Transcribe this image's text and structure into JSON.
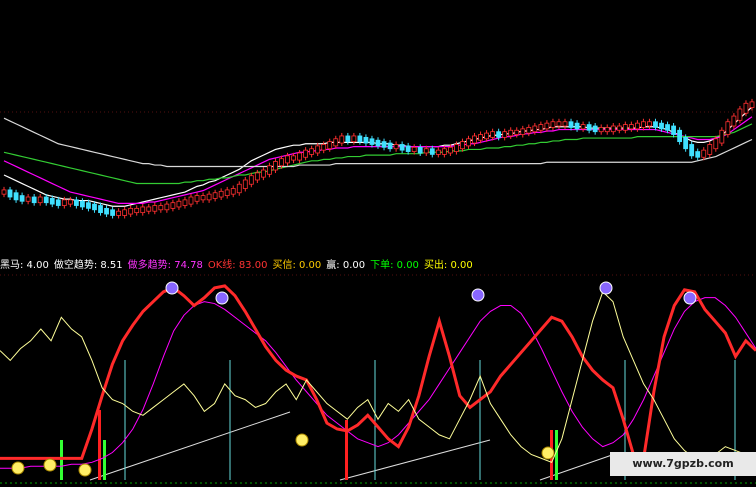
{
  "chart_data": [
    {
      "type": "candlestick",
      "title": "",
      "xlabel": "",
      "ylabel": "",
      "ylim": [
        0,
        100
      ],
      "series": [
        {
          "kind": "candles",
          "values_close": [
            38,
            36,
            34,
            33,
            33,
            32,
            33,
            32,
            31,
            30,
            31,
            31,
            30,
            29,
            28,
            27,
            25,
            24,
            23,
            23,
            24,
            25,
            25,
            26,
            26,
            27,
            27,
            28,
            29,
            30,
            31,
            33,
            34,
            34,
            35,
            36,
            37,
            38,
            39,
            42,
            45,
            48,
            50,
            52,
            55,
            58,
            60,
            62,
            62,
            64,
            66,
            67,
            69,
            70,
            72,
            74,
            76,
            75,
            76,
            75,
            74,
            73,
            72,
            71,
            70,
            70,
            69,
            68,
            68,
            67,
            67,
            66,
            66,
            67,
            68,
            70,
            72,
            74,
            76,
            77,
            78,
            79,
            78,
            79,
            80,
            80,
            81,
            82,
            83,
            84,
            85,
            86,
            86,
            86,
            85,
            84,
            84,
            83,
            82,
            82,
            82,
            83,
            83,
            84,
            84,
            85,
            86,
            86,
            85,
            84,
            83,
            80,
            75,
            70,
            65,
            64,
            66,
            70,
            74,
            80,
            86,
            90,
            95,
            99,
            100
          ]
        },
        {
          "kind": "ma",
          "color": "#ffffff",
          "values": [
            50,
            48,
            46,
            44,
            42,
            40,
            38,
            36,
            35,
            34,
            33,
            33,
            32,
            32,
            32,
            31,
            30,
            29,
            28,
            28,
            28,
            29,
            30,
            31,
            32,
            33,
            34,
            35,
            36,
            37,
            38,
            40,
            42,
            43,
            45,
            46,
            48,
            50,
            52,
            54,
            57,
            60,
            62,
            64,
            66,
            68,
            69,
            70,
            71,
            71,
            72,
            72,
            72,
            72,
            73,
            73,
            73,
            73,
            73,
            73,
            73,
            73,
            72,
            72,
            72,
            71,
            71,
            70,
            70,
            70,
            70,
            70,
            70,
            71,
            71,
            72,
            73,
            74,
            75,
            76,
            77,
            78,
            78,
            79,
            79,
            80,
            81,
            81,
            82,
            82,
            83,
            84,
            84,
            84,
            84,
            84,
            84,
            83,
            83,
            83,
            83,
            83,
            83,
            83,
            83,
            83,
            84,
            84,
            84,
            83,
            82,
            80,
            78,
            76,
            74,
            73,
            73,
            74,
            76,
            78,
            82,
            86,
            90,
            94,
            98
          ]
        },
        {
          "kind": "ma",
          "color": "#ff00ff",
          "values": [
            60,
            58,
            56,
            54,
            52,
            50,
            48,
            46,
            44,
            42,
            40,
            38,
            37,
            36,
            35,
            34,
            33,
            32,
            31,
            30,
            30,
            30,
            30,
            30,
            31,
            31,
            32,
            33,
            34,
            35,
            36,
            37,
            38,
            39,
            41,
            43,
            45,
            47,
            49,
            51,
            53,
            55,
            57,
            59,
            61,
            62,
            63,
            64,
            65,
            66,
            66,
            67,
            67,
            68,
            68,
            69,
            69,
            69,
            70,
            70,
            70,
            70,
            70,
            70,
            70,
            70,
            70,
            70,
            70,
            70,
            70,
            70,
            70,
            70,
            70,
            71,
            71,
            72,
            72,
            73,
            74,
            75,
            76,
            77,
            77,
            78,
            79,
            79,
            80,
            80,
            81,
            81,
            82,
            82,
            82,
            82,
            82,
            82,
            82,
            82,
            82,
            82,
            82,
            82,
            82,
            82,
            82,
            82,
            82,
            81,
            80,
            79,
            78,
            77,
            76,
            75,
            75,
            75,
            76,
            77,
            79,
            82,
            85,
            88,
            91
          ]
        },
        {
          "kind": "ma",
          "color": "#33cc33",
          "values": [
            66,
            65,
            64,
            63,
            62,
            61,
            60,
            59,
            58,
            57,
            56,
            55,
            54,
            53,
            52,
            51,
            50,
            49,
            48,
            47,
            46,
            45,
            44,
            44,
            44,
            44,
            44,
            44,
            44,
            44,
            45,
            45,
            46,
            46,
            47,
            47,
            48,
            48,
            49,
            50,
            50,
            51,
            52,
            52,
            53,
            54,
            55,
            56,
            57,
            58,
            59,
            60,
            60,
            61,
            61,
            62,
            62,
            63,
            63,
            63,
            64,
            64,
            64,
            64,
            64,
            65,
            65,
            65,
            65,
            65,
            66,
            66,
            66,
            66,
            67,
            67,
            67,
            68,
            68,
            68,
            69,
            69,
            69,
            70,
            70,
            71,
            71,
            72,
            72,
            73,
            73,
            74,
            74,
            75,
            75,
            75,
            76,
            76,
            76,
            76,
            76,
            76,
            76,
            76,
            76,
            77,
            77,
            77,
            77,
            77,
            77,
            77,
            77,
            77,
            77,
            77,
            77,
            77,
            77,
            78,
            79,
            80,
            82,
            84,
            86
          ]
        },
        {
          "kind": "ma",
          "color": "#d9d9d9",
          "values": [
            90,
            88,
            86,
            84,
            82,
            80,
            78,
            76,
            74,
            72,
            71,
            70,
            69,
            68,
            67,
            66,
            65,
            64,
            63,
            62,
            61,
            60,
            59,
            58,
            58,
            57,
            57,
            56,
            56,
            56,
            56,
            56,
            56,
            56,
            56,
            56,
            56,
            56,
            56,
            56,
            56,
            56,
            56,
            56,
            56,
            56,
            56,
            56,
            56,
            57,
            57,
            57,
            57,
            57,
            57,
            58,
            58,
            58,
            58,
            58,
            58,
            58,
            58,
            58,
            58,
            58,
            58,
            58,
            58,
            58,
            58,
            58,
            58,
            58,
            58,
            58,
            58,
            58,
            58,
            58,
            58,
            58,
            58,
            58,
            58,
            58,
            58,
            58,
            58,
            58,
            59,
            59,
            59,
            59,
            59,
            59,
            59,
            59,
            59,
            59,
            59,
            59,
            59,
            59,
            59,
            59,
            59,
            59,
            59,
            59,
            59,
            59,
            59,
            59,
            59,
            60,
            61,
            62,
            63,
            65,
            67,
            69,
            71,
            73,
            75
          ]
        }
      ]
    },
    {
      "type": "line",
      "legend": [
        {
          "text": "黑马: 4.00",
          "color": "#ffffff"
        },
        {
          "text": "做空趋势: 8.51",
          "color": "#ffffff"
        },
        {
          "text": "做多趋势: 74.78",
          "color": "#ff33ff"
        },
        {
          "text": "OK线: 83.00",
          "color": "#ff3333"
        },
        {
          "text": "买信: 0.00",
          "color": "#ffcc00"
        },
        {
          "text": "赢: 0.00",
          "color": "#ffffff"
        },
        {
          "text": "下单: 0.00",
          "color": "#00ff00"
        },
        {
          "text": "买出: 0.00",
          "color": "#ffff00"
        }
      ],
      "ylim": [
        0,
        100
      ],
      "series": [
        {
          "name": "做多趋势",
          "color": "#ff00ff",
          "values": [
            5,
            5,
            5,
            6,
            6,
            6,
            6,
            7,
            7,
            8,
            10,
            13,
            18,
            25,
            35,
            48,
            62,
            75,
            83,
            88,
            90,
            89,
            86,
            82,
            78,
            74,
            70,
            64,
            57,
            50,
            44,
            38,
            32,
            28,
            24,
            20,
            18,
            16,
            18,
            22,
            28,
            34,
            40,
            48,
            56,
            64,
            72,
            80,
            85,
            88,
            88,
            84,
            76,
            66,
            55,
            44,
            34,
            26,
            20,
            16,
            18,
            22,
            30,
            40,
            52,
            64,
            76,
            85,
            90,
            92,
            92,
            88,
            82,
            74,
            66
          ]
        },
        {
          "name": "OK线",
          "color": "#ff2a2a",
          "values": [
            10,
            10,
            10,
            10,
            10,
            10,
            10,
            10,
            10,
            25,
            42,
            58,
            70,
            78,
            85,
            90,
            95,
            97,
            93,
            88,
            92,
            97,
            98,
            93,
            85,
            76,
            67,
            60,
            55,
            52,
            50,
            40,
            28,
            25,
            24,
            27,
            32,
            26,
            20,
            16,
            26,
            42,
            62,
            80,
            62,
            42,
            36,
            40,
            44,
            52,
            58,
            64,
            70,
            76,
            82,
            80,
            72,
            62,
            55,
            50,
            46,
            30,
            12,
            10,
            44,
            72,
            88,
            96,
            95,
            86,
            80,
            74,
            62,
            70,
            65
          ]
        },
        {
          "name": "做空趋势",
          "color": "#ffff99",
          "values": [
            65,
            60,
            66,
            70,
            76,
            70,
            82,
            76,
            72,
            60,
            46,
            40,
            38,
            34,
            32,
            36,
            40,
            44,
            48,
            42,
            34,
            38,
            48,
            42,
            40,
            36,
            38,
            44,
            48,
            40,
            50,
            44,
            38,
            34,
            30,
            36,
            40,
            30,
            38,
            34,
            40,
            30,
            26,
            22,
            20,
            30,
            40,
            52,
            38,
            30,
            22,
            16,
            12,
            10,
            8,
            20,
            40,
            60,
            80,
            95,
            90,
            72,
            60,
            48,
            40,
            30,
            20,
            14,
            10,
            8,
            12,
            16,
            14,
            12,
            10
          ]
        }
      ]
    }
  ],
  "watermark": "www.7gpzb.com"
}
